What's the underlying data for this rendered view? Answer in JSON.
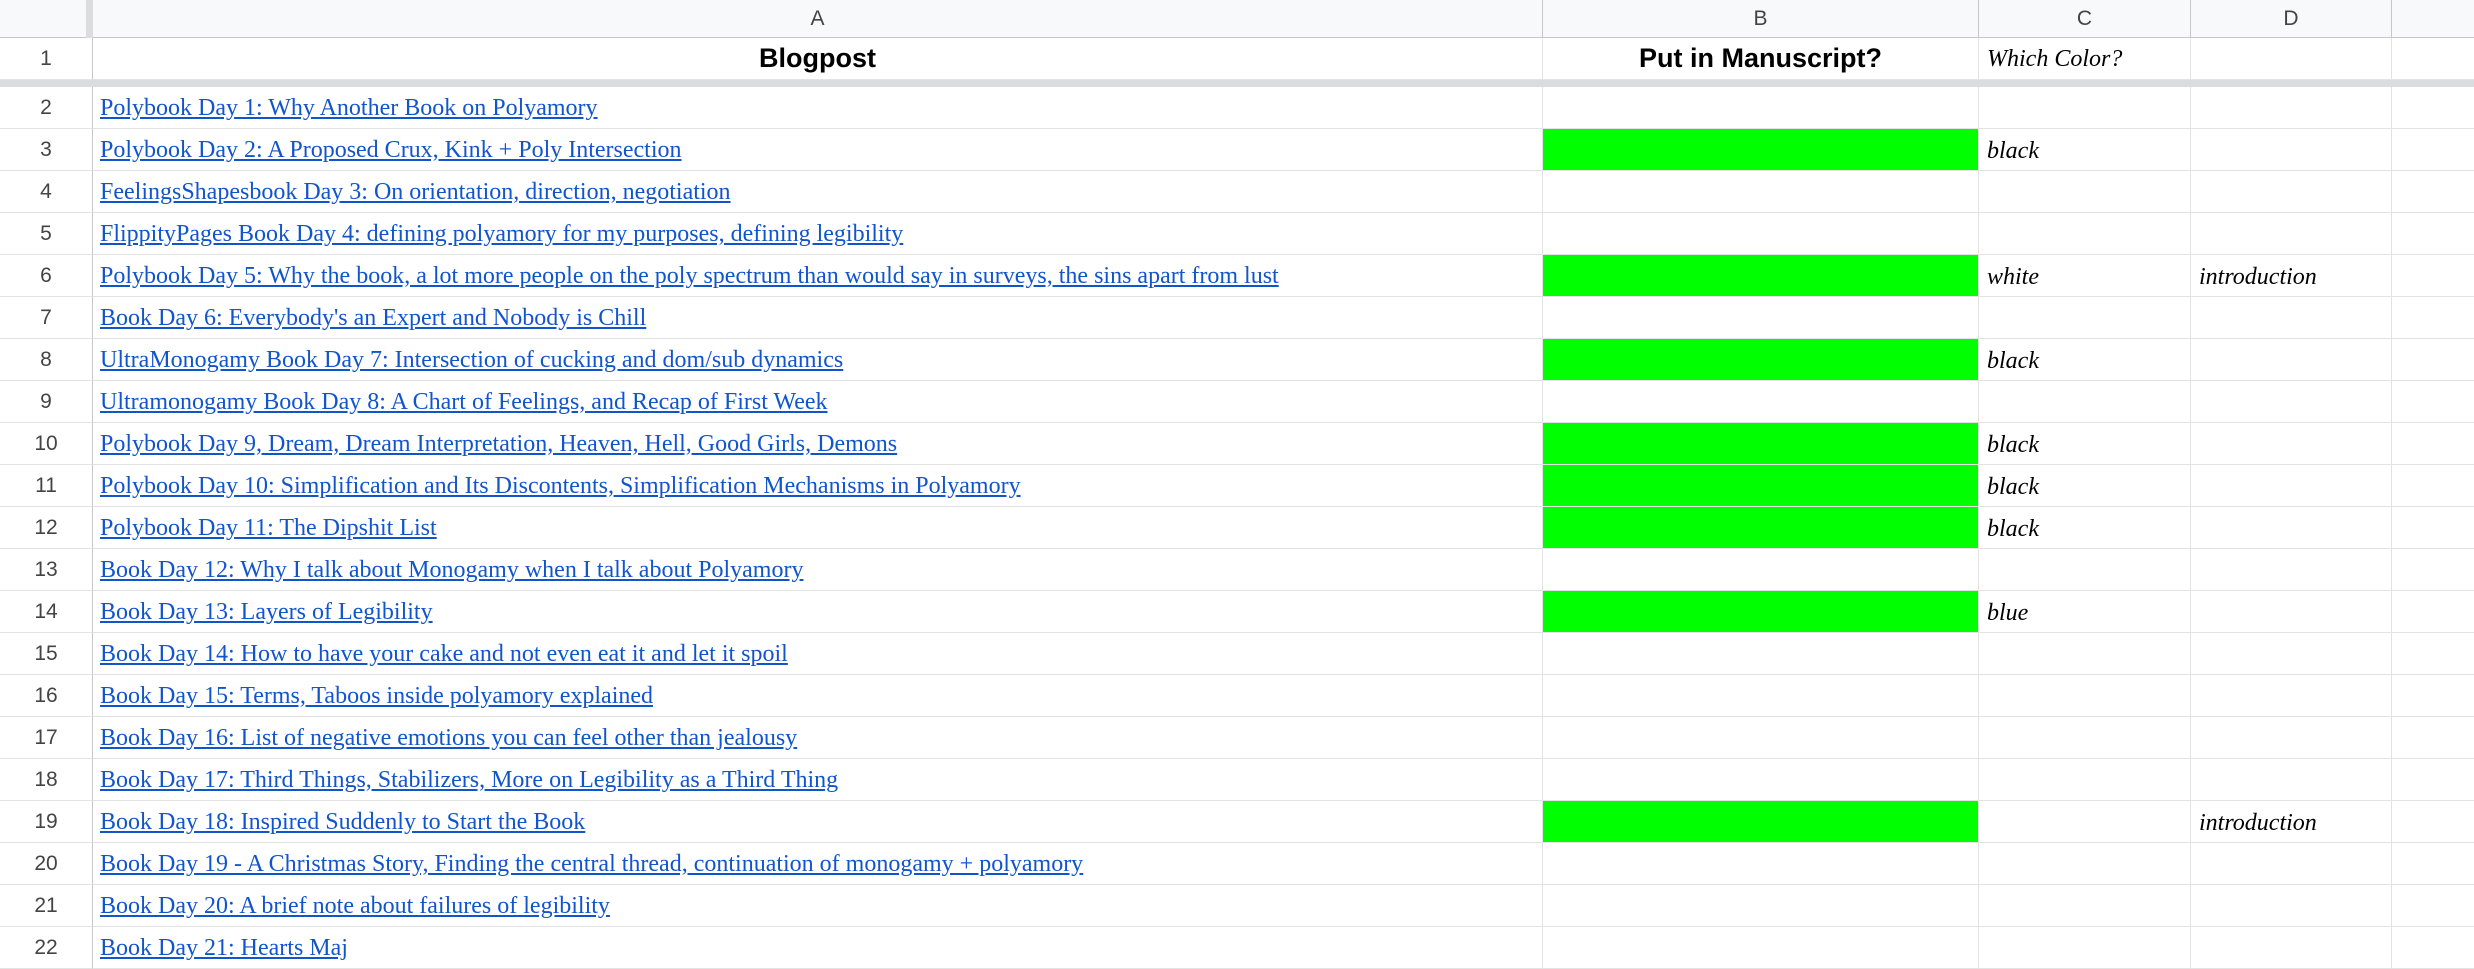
{
  "columns": [
    "A",
    "B",
    "C",
    "D"
  ],
  "header": {
    "row_number": "1",
    "a": "Blogpost",
    "b": "Put in Manuscript?",
    "c": "Which Color?",
    "d": ""
  },
  "highlight_color": "#00ff00",
  "link_color": "#1155cc",
  "rows": [
    {
      "num": "2",
      "title": "Polybook Day 1: Why Another Book on Polyamory",
      "manuscript": false,
      "color": "",
      "section": ""
    },
    {
      "num": "3",
      "title": "Polybook Day 2: A Proposed Crux, Kink + Poly Intersection",
      "manuscript": true,
      "color": "black",
      "section": ""
    },
    {
      "num": "4",
      "title": "FeelingsShapesbook Day 3: On orientation, direction, negotiation",
      "manuscript": false,
      "color": "",
      "section": ""
    },
    {
      "num": "5",
      "title": "FlippityPages Book Day 4: defining polyamory for my purposes, defining legibility",
      "manuscript": false,
      "color": "",
      "section": ""
    },
    {
      "num": "6",
      "title": "Polybook Day 5: Why the book, a lot more people on the poly spectrum than would say in surveys, the sins apart from lust",
      "manuscript": true,
      "color": "white",
      "section": "introduction"
    },
    {
      "num": "7",
      "title": "Book Day 6: Everybody's an Expert and Nobody is Chill",
      "manuscript": false,
      "color": "",
      "section": ""
    },
    {
      "num": "8",
      "title": "UltraMonogamy Book Day 7: Intersection of cucking and dom/sub dynamics",
      "manuscript": true,
      "color": "black",
      "section": ""
    },
    {
      "num": "9",
      "title": "Ultramonogamy Book Day 8: A Chart of Feelings, and Recap of First Week",
      "manuscript": false,
      "color": "",
      "section": ""
    },
    {
      "num": "10",
      "title": "Polybook Day 9, Dream, Dream Interpretation, Heaven, Hell, Good Girls, Demons",
      "manuscript": true,
      "color": "black",
      "section": ""
    },
    {
      "num": "11",
      "title": "Polybook Day 10: Simplification and Its Discontents, Simplification Mechanisms in Polyamory",
      "manuscript": true,
      "color": "black",
      "section": ""
    },
    {
      "num": "12",
      "title": "Polybook Day 11: The Dipshit List",
      "manuscript": true,
      "color": "black",
      "section": ""
    },
    {
      "num": "13",
      "title": "Book Day 12: Why I talk about Monogamy when I talk about Polyamory",
      "manuscript": false,
      "color": "",
      "section": ""
    },
    {
      "num": "14",
      "title": "Book Day 13: Layers of Legibility",
      "manuscript": true,
      "color": "blue",
      "section": ""
    },
    {
      "num": "15",
      "title": "Book Day 14: How to have your cake and not even eat it and let it spoil",
      "manuscript": false,
      "color": "",
      "section": ""
    },
    {
      "num": "16",
      "title": "Book Day 15: Terms, Taboos inside polyamory explained",
      "manuscript": false,
      "color": "",
      "section": ""
    },
    {
      "num": "17",
      "title": "Book Day 16: List of negative emotions you can feel other than jealousy",
      "manuscript": false,
      "color": "",
      "section": ""
    },
    {
      "num": "18",
      "title": "Book Day 17: Third Things, Stabilizers, More on Legibility as a Third Thing",
      "manuscript": false,
      "color": "",
      "section": ""
    },
    {
      "num": "19",
      "title": "Book Day 18: Inspired Suddenly to Start the Book",
      "manuscript": true,
      "color": "",
      "section": "introduction"
    },
    {
      "num": "20",
      "title": "Book Day 19 - A Christmas Story, Finding the central thread, continuation of monogamy + polyamory",
      "manuscript": false,
      "color": "",
      "section": ""
    },
    {
      "num": "21",
      "title": "Book Day 20: A brief note about failures of legibility",
      "manuscript": false,
      "color": "",
      "section": ""
    },
    {
      "num": "22",
      "title": "Book Day 21: Hearts Maj",
      "manuscript": false,
      "color": "",
      "section": ""
    }
  ]
}
